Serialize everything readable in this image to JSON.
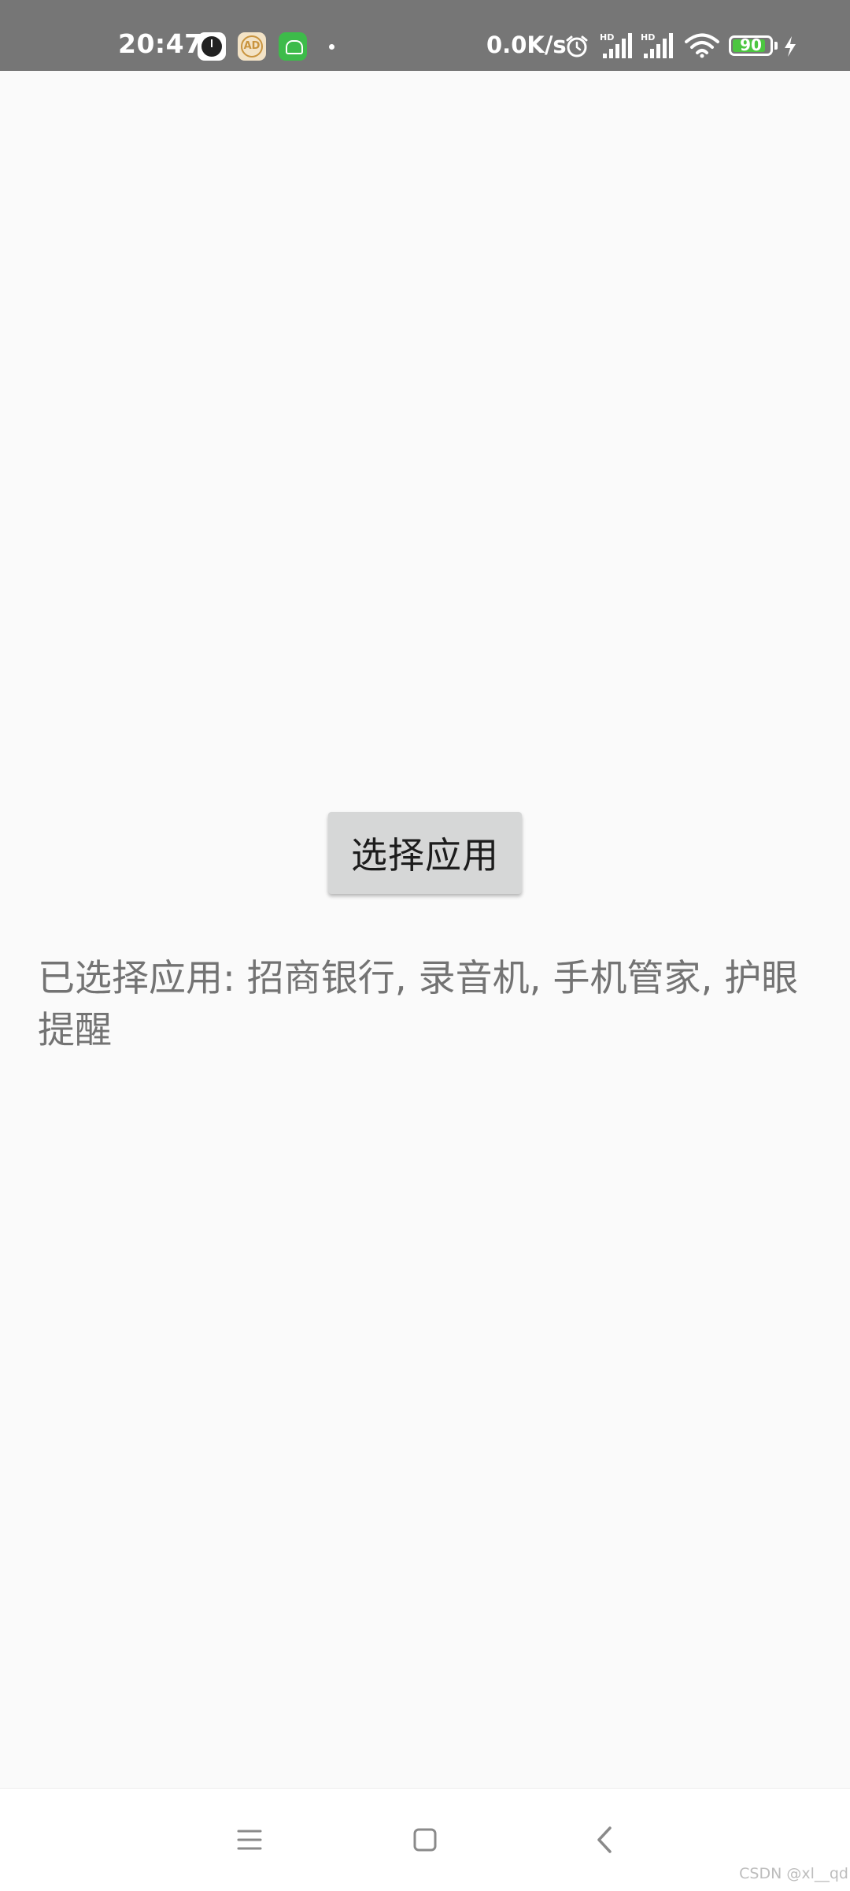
{
  "status_bar": {
    "time": "20:47",
    "ad_badge_text": "AD",
    "network_speed": "0.0K/s",
    "battery_level": "90",
    "battery_fraction": 0.9,
    "icons": [
      "clock-app-icon",
      "ad-app-icon",
      "android-app-icon",
      "alarm-icon",
      "signal-hd-icon",
      "signal-hd-icon",
      "wifi-icon",
      "battery-icon",
      "charging-icon"
    ]
  },
  "main": {
    "select_button_label": "选择应用",
    "selected_apps_text": "已选择应用: 招商银行, 录音机, 手机管家, 护眼提醒"
  },
  "nav_bar": {
    "icons": [
      "menu-icon",
      "home-icon",
      "back-icon"
    ]
  },
  "watermark": "CSDN @xl__qd",
  "colors": {
    "status_bar_bg": "#767676",
    "page_bg": "#fafafa",
    "button_bg": "#d6d7d7",
    "battery_fill": "#4cc640"
  }
}
